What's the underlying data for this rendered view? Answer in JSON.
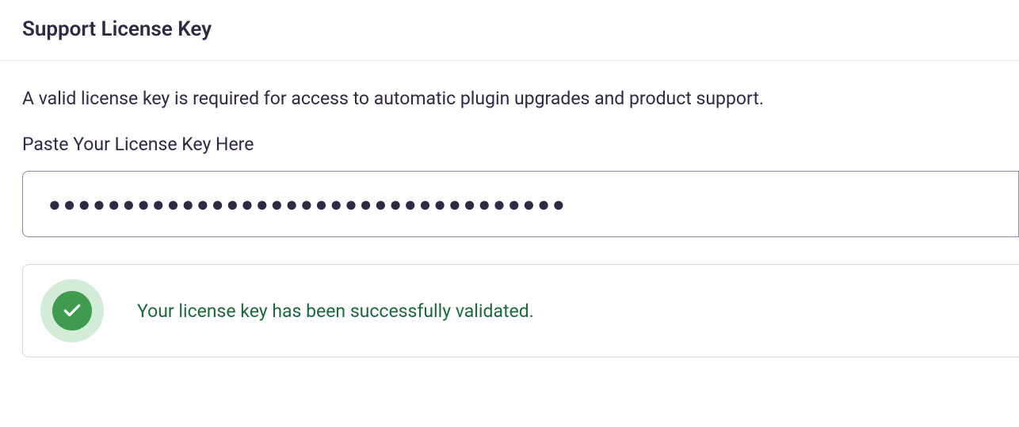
{
  "header": {
    "title": "Support License Key"
  },
  "body": {
    "description": "A valid license key is required for access to automatic plugin upgrades and product support.",
    "field_label": "Paste Your License Key Here",
    "license_value": "●●●●●●●●●●●●●●●●●●●●●●●●●●●●●●●●●●●"
  },
  "status": {
    "message": "Your license key has been successfully validated.",
    "icon": "check-icon",
    "color_bg_outer": "#d3ecd8",
    "color_bg_inner": "#3f9c4f",
    "color_text": "#1a6b3a"
  }
}
